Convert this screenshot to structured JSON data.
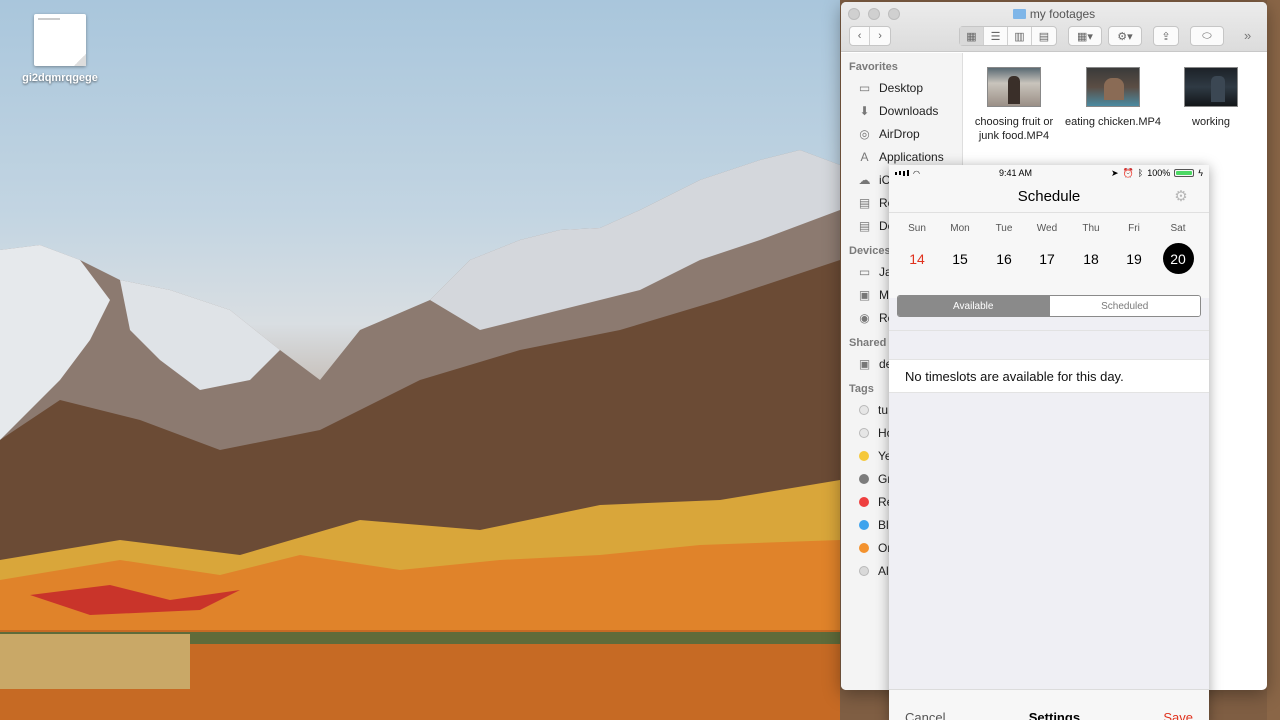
{
  "desktop": {
    "file_name": "gi2dqmrqgege"
  },
  "finder": {
    "title": "my footages",
    "overflow": "»",
    "sidebar": {
      "favorites_header": "Favorites",
      "favorites": [
        {
          "label": "Desktop",
          "icon": "desktop-icon"
        },
        {
          "label": "Downloads",
          "icon": "downloads-icon"
        },
        {
          "label": "AirDrop",
          "icon": "airdrop-icon"
        },
        {
          "label": "Applications",
          "icon": "applications-icon"
        },
        {
          "label": "iC",
          "icon": "icloud-icon"
        },
        {
          "label": "Re",
          "icon": "recents-icon"
        },
        {
          "label": "Do",
          "icon": "documents-icon"
        }
      ],
      "devices_header": "Devices",
      "devices": [
        {
          "label": "Ja",
          "icon": "laptop-icon"
        },
        {
          "label": "M",
          "icon": "disk-icon"
        },
        {
          "label": "Re",
          "icon": "disc-icon"
        }
      ],
      "shared_header": "Shared",
      "shared": [
        {
          "label": "de",
          "icon": "display-icon"
        }
      ],
      "tags_header": "Tags",
      "tags": [
        {
          "label": "tu",
          "color": "#e6e6e6"
        },
        {
          "label": "Ho",
          "color": "#e6e6e6"
        },
        {
          "label": "Ye",
          "color": "#f5c83a"
        },
        {
          "label": "Gr",
          "color": "#7c7c7c"
        },
        {
          "label": "Re",
          "color": "#ee3f3f"
        },
        {
          "label": "Bl",
          "color": "#3ea3ed"
        },
        {
          "label": "Or",
          "color": "#f3922e"
        },
        {
          "label": "Al",
          "color": "#d9d9d9"
        }
      ]
    },
    "files": [
      {
        "name": "choosing fruit or junk food.MP4"
      },
      {
        "name": "eating chicken.MP4"
      },
      {
        "name": "working"
      }
    ]
  },
  "phone": {
    "status": {
      "time": "9:41 AM",
      "battery": "100%"
    },
    "title": "Schedule",
    "week": [
      {
        "name": "Sun",
        "num": "14"
      },
      {
        "name": "Mon",
        "num": "15"
      },
      {
        "name": "Tue",
        "num": "16"
      },
      {
        "name": "Wed",
        "num": "17"
      },
      {
        "name": "Thu",
        "num": "18"
      },
      {
        "name": "Fri",
        "num": "19"
      },
      {
        "name": "Sat",
        "num": "20"
      }
    ],
    "segments": {
      "available": "Available",
      "scheduled": "Scheduled"
    },
    "empty_message": "No timeslots are available for this day.",
    "tabs": {
      "cancel": "Cancel",
      "settings": "Settings",
      "save": "Save"
    },
    "colors": {
      "today": "#e0321e",
      "selected": "#000000",
      "accent": "#e0321e"
    }
  }
}
